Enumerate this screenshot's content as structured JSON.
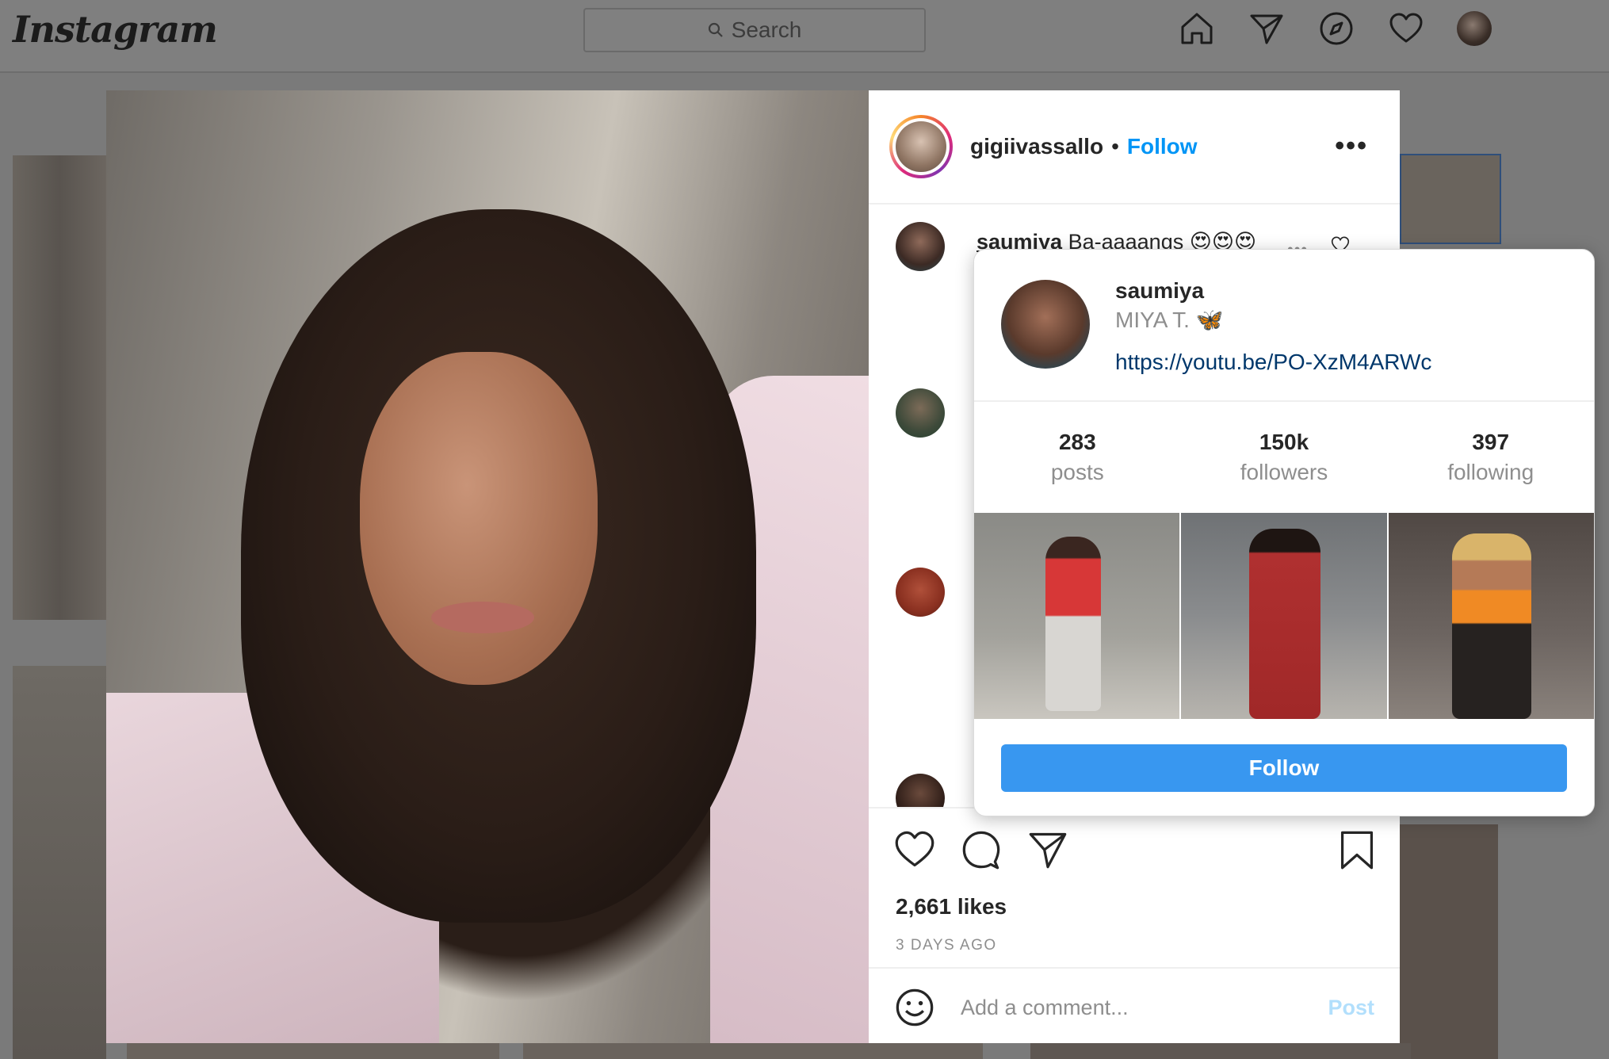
{
  "header": {
    "logo": "Instagram",
    "search_placeholder": "Search",
    "nav_icons": [
      "home-icon",
      "direct-icon",
      "explore-icon",
      "activity-heart-icon",
      "profile-avatar"
    ]
  },
  "post": {
    "username": "gigiivassallo",
    "separator": "•",
    "follow_label": "Follow",
    "more_label": "•••",
    "likes": "2,661 likes",
    "time_ago": "3 DAYS AGO",
    "comment_placeholder": "Add a comment...",
    "post_button": "Post"
  },
  "comments": [
    {
      "username": "saumiya",
      "text": "Ba-aaaangs 😍😍😍"
    }
  ],
  "hover_card": {
    "username": "saumiya",
    "full_name": "MIYA T. 🦋",
    "link": "https://youtu.be/PO-XzM4ARWc",
    "stats": [
      {
        "value": "283",
        "label": "posts"
      },
      {
        "value": "150k",
        "label": "followers"
      },
      {
        "value": "397",
        "label": "following"
      }
    ],
    "follow_button": "Follow"
  },
  "colors": {
    "accent_blue": "#0095f6",
    "button_blue": "#3897f0",
    "link_dark": "#00376b",
    "muted": "#8e8e8e"
  }
}
